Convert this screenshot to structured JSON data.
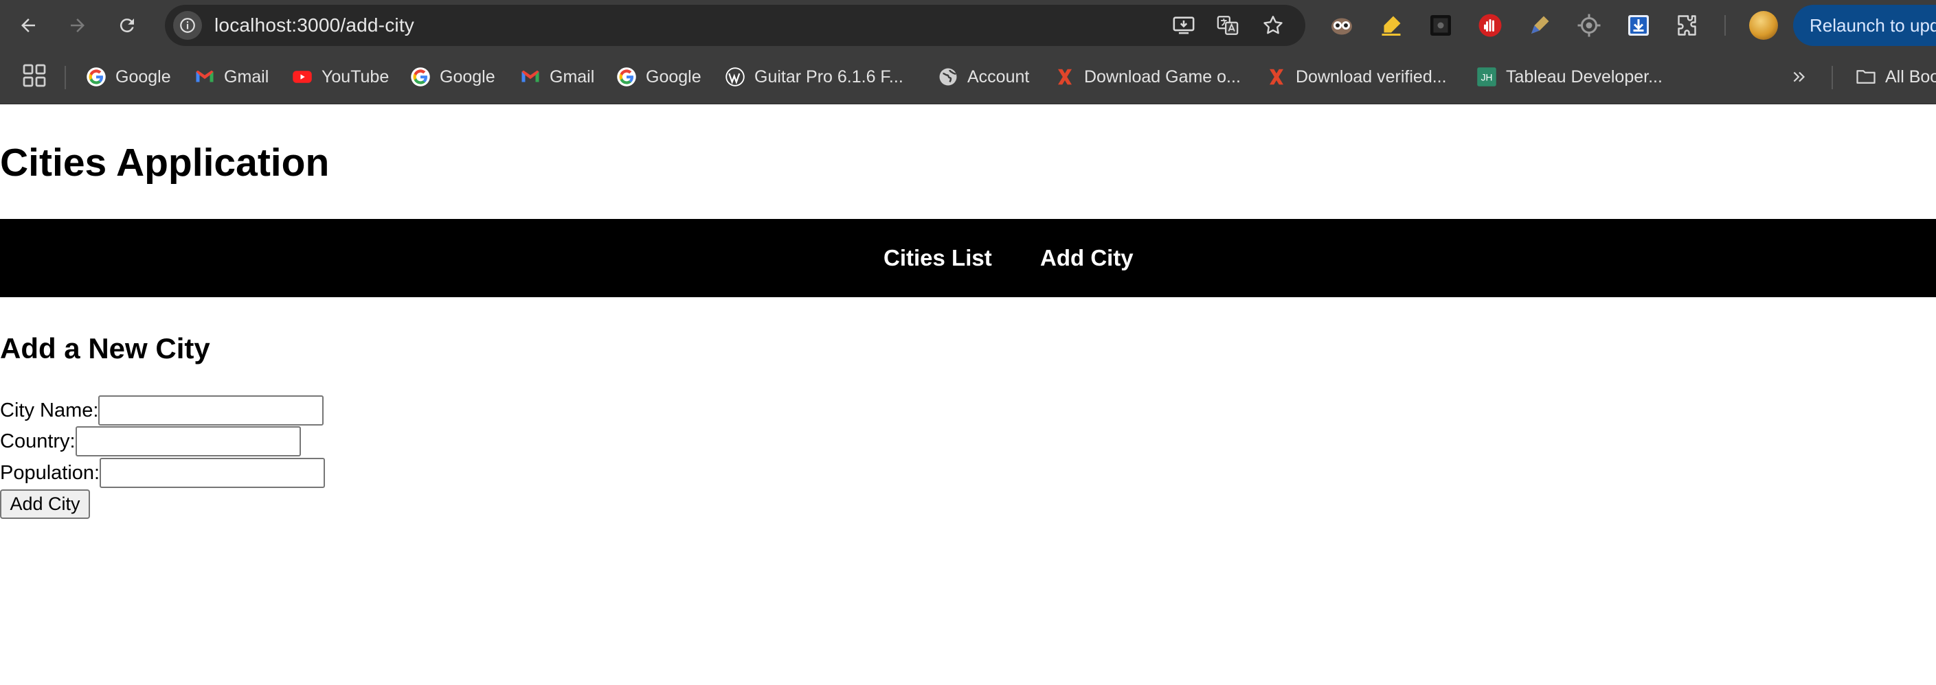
{
  "browser": {
    "url": "localhost:3000/add-city",
    "relaunch_label": "Relaunch to update",
    "bookmarks": [
      {
        "label": "Google",
        "icon": "google-icon"
      },
      {
        "label": "Gmail",
        "icon": "gmail-icon"
      },
      {
        "label": "YouTube",
        "icon": "youtube-icon"
      },
      {
        "label": "Google",
        "icon": "google-icon"
      },
      {
        "label": "Gmail",
        "icon": "gmail-icon"
      },
      {
        "label": "Google",
        "icon": "google-icon"
      },
      {
        "label": "Guitar Pro 6.1.6 F...",
        "icon": "wordpress-icon"
      },
      {
        "label": "Account",
        "icon": "globe-icon"
      },
      {
        "label": "Download Game o...",
        "icon": "x-logo-icon"
      },
      {
        "label": "Download verified...",
        "icon": "x-logo-icon"
      },
      {
        "label": "Tableau Developer...",
        "icon": "jh-icon"
      }
    ],
    "all_bookmarks_label": "All Bookmarks"
  },
  "page": {
    "title": "Cities Application",
    "nav": {
      "cities_list": "Cities List",
      "add_city": "Add City"
    },
    "section_title": "Add a New City",
    "form": {
      "city_name_label": "City Name:",
      "city_name_value": "",
      "country_label": "Country:",
      "country_value": "",
      "population_label": "Population:",
      "population_value": "",
      "submit_label": "Add City"
    }
  },
  "colors": {
    "chrome_bg": "#3c3c3c",
    "omnibox_bg": "#282828",
    "navbar_bg": "#000000",
    "relaunch_bg": "#0b4a8a"
  }
}
